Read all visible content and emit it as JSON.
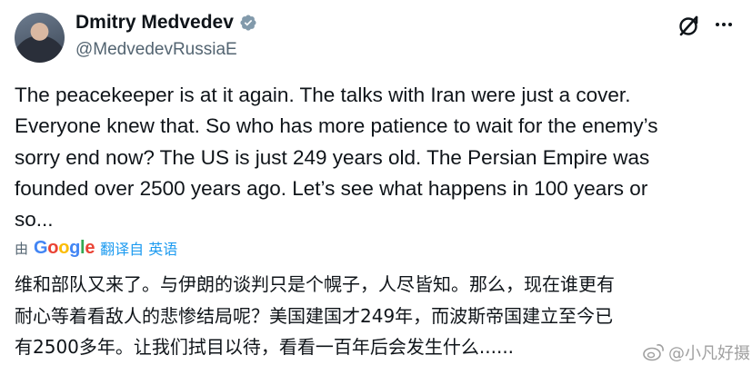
{
  "author": {
    "display_name": "Dmitry Medvedev",
    "handle": "@MedvedevRussiaE",
    "verified": true
  },
  "tweet": {
    "lines": [
      "The peacekeeper is at it again. The talks with Iran were just a cover.",
      "Everyone knew that. So who has more patience to wait for the enemy’s",
      "sorry end now? The US is just 249 years old. The Persian Empire was",
      "founded over 2500 years ago. Let’s see what happens in 100 years or",
      "so..."
    ]
  },
  "translation": {
    "by_label": "由",
    "google": [
      "G",
      "o",
      "o",
      "g",
      "l",
      "e"
    ],
    "link_label": "翻译自 英语",
    "lines": [
      "维和部队又来了。与伊朗的谈判只是个幌子，人尽皆知。那么，现在谁更有",
      "耐心等着看敌人的悲惨结局呢？美国建国才249年，而波斯帝国建立至今已",
      "有2500多年。让我们拭目以待，看看一百年后会发生什么......"
    ]
  },
  "watermark": {
    "text": "@小凡好摄"
  },
  "icons": {
    "verified": "verified-badge-icon",
    "grok": "grok-icon",
    "more": "more-options-icon",
    "watermark": "weibo-icon"
  },
  "colors": {
    "text_primary": "#0f1419",
    "text_secondary": "#536471",
    "link": "#1d9bf0",
    "verified_badge": "#829aab"
  }
}
